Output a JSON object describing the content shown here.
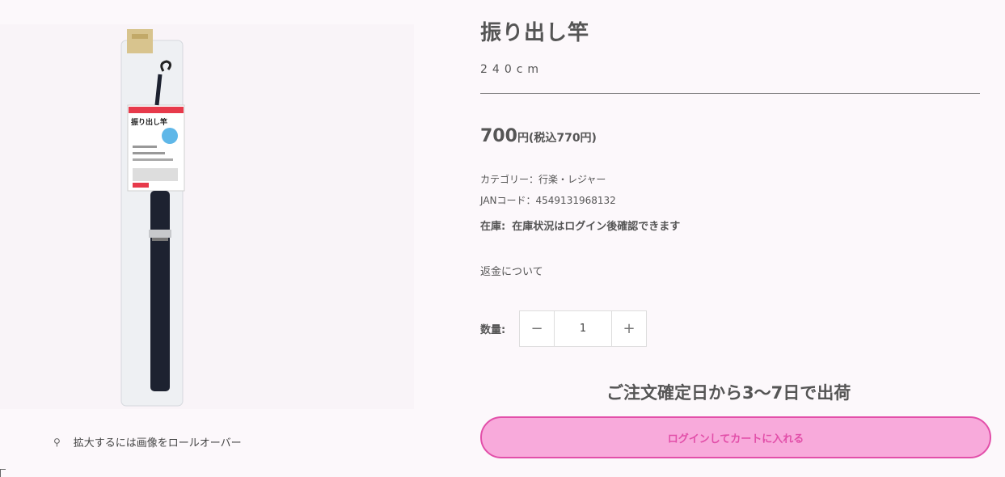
{
  "product": {
    "title": "振り出し竿",
    "variant": "240cm",
    "price_main": "700",
    "price_tax": "円(税込770円)",
    "category": "カテゴリー：行楽・レジャー",
    "jan": "JANコード：4549131968132",
    "stock_label": "在庫:",
    "stock_value": "在庫状況はログイン後確認できます",
    "refund_link": "返金について",
    "quantity_label": "数量:",
    "quantity_value": "1",
    "ship_notice": "ご注文確定日から3〜7日で出荷",
    "cart_button": "ログインしてカートに入れる"
  },
  "gallery": {
    "zoom_hint": "拡大するには画像をロールオーバー",
    "package_text": "振り出し竿"
  },
  "icons": {
    "zoom": "magnifier-icon",
    "minus": "minus-icon",
    "plus": "plus-icon"
  },
  "colors": {
    "accent": "#e24fa9",
    "button_fill": "#f8aadb"
  }
}
